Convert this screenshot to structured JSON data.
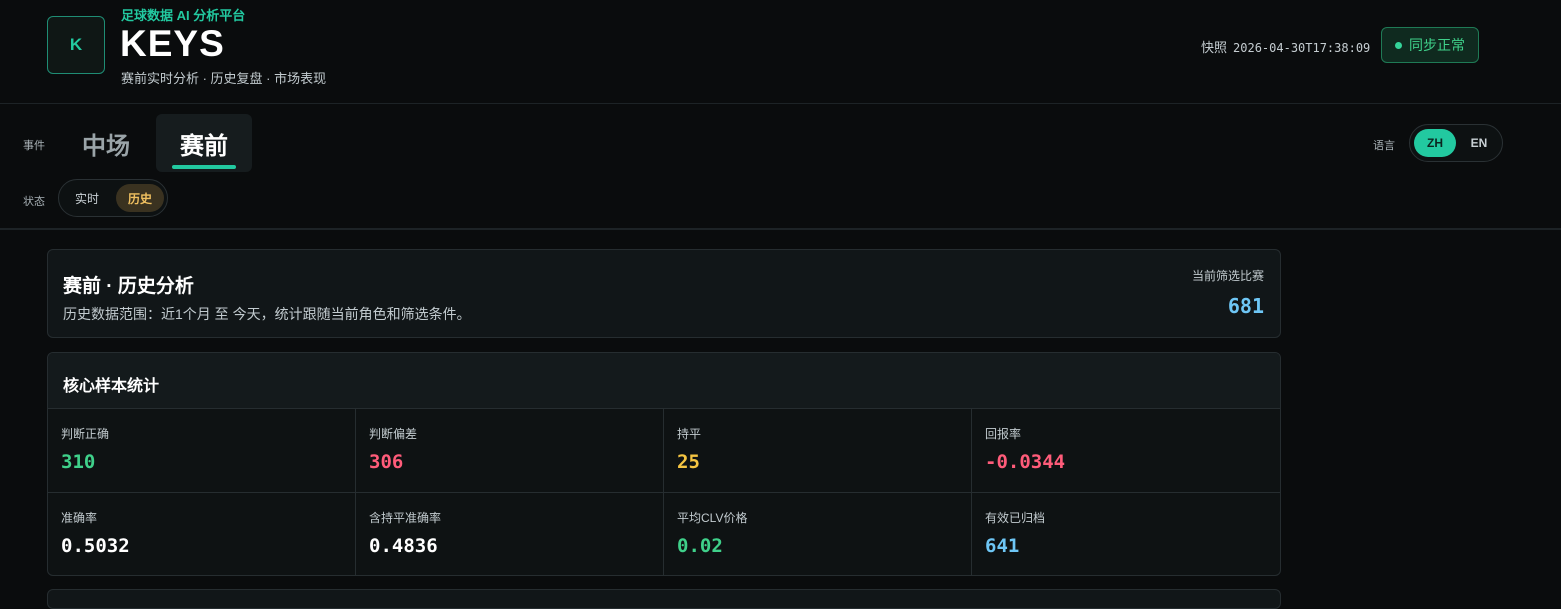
{
  "header": {
    "logo_letter": "K",
    "platform_name": "足球数据 AI 分析平台",
    "title": "KEYS",
    "subtitle": "赛前实时分析 · 历史复盘 · 市场表现",
    "snapshot_label": "快照",
    "snapshot_time": "2026-04-30T17:38:09",
    "sync_status": "同步正常"
  },
  "controls": {
    "event_label": "事件",
    "event_tabs": [
      "中场",
      "赛前"
    ],
    "active_event": "赛前",
    "state_label": "状态",
    "state_options": [
      "实时",
      "历史"
    ],
    "active_state": "历史",
    "language_label": "语言",
    "language_options": [
      "ZH",
      "EN"
    ],
    "active_language": "ZH"
  },
  "summary": {
    "title": "赛前 · 历史分析",
    "description": "历史数据范围：近1个月 至 今天，统计跟随当前角色和筛选条件。",
    "count_label": "当前筛选比赛",
    "count_value": "681"
  },
  "stats": {
    "title": "核心样本统计",
    "items": [
      {
        "label": "判断正确",
        "value": "310",
        "color": "#3fd08a"
      },
      {
        "label": "判断偏差",
        "value": "306",
        "color": "#ff5c7a"
      },
      {
        "label": "持平",
        "value": "25",
        "color": "#f5c542"
      },
      {
        "label": "回报率",
        "value": "-0.0344",
        "color": "#ff5c7a"
      },
      {
        "label": "准确率",
        "value": "0.5032",
        "color": "#ffffff"
      },
      {
        "label": "含持平准确率",
        "value": "0.4836",
        "color": "#ffffff"
      },
      {
        "label": "平均CLV价格",
        "value": "0.02",
        "color": "#3fd08a"
      },
      {
        "label": "有效已归档",
        "value": "641",
        "color": "#6ec6f5"
      }
    ]
  }
}
